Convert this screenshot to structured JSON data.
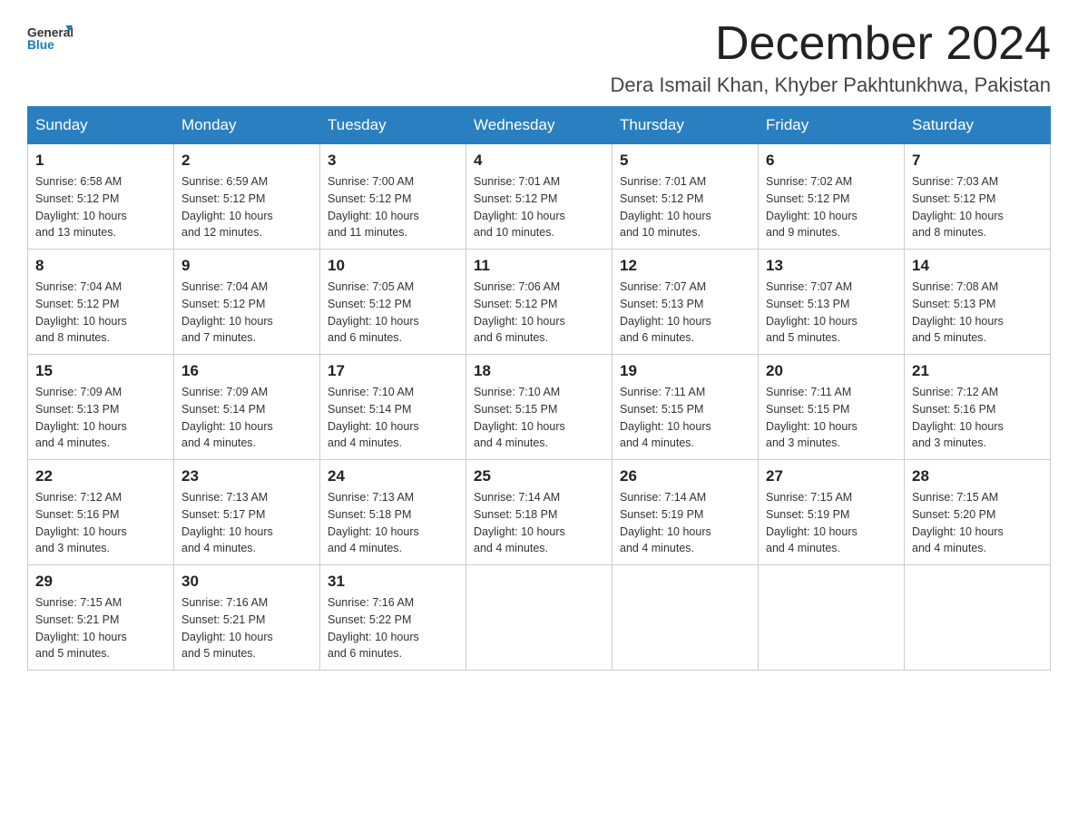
{
  "header": {
    "logo_general": "General",
    "logo_blue": "Blue",
    "month_title": "December 2024",
    "location": "Dera Ismail Khan, Khyber Pakhtunkhwa, Pakistan"
  },
  "weekdays": [
    "Sunday",
    "Monday",
    "Tuesday",
    "Wednesday",
    "Thursday",
    "Friday",
    "Saturday"
  ],
  "weeks": [
    [
      {
        "day": "1",
        "sunrise": "6:58 AM",
        "sunset": "5:12 PM",
        "daylight": "10 hours and 13 minutes."
      },
      {
        "day": "2",
        "sunrise": "6:59 AM",
        "sunset": "5:12 PM",
        "daylight": "10 hours and 12 minutes."
      },
      {
        "day": "3",
        "sunrise": "7:00 AM",
        "sunset": "5:12 PM",
        "daylight": "10 hours and 11 minutes."
      },
      {
        "day": "4",
        "sunrise": "7:01 AM",
        "sunset": "5:12 PM",
        "daylight": "10 hours and 10 minutes."
      },
      {
        "day": "5",
        "sunrise": "7:01 AM",
        "sunset": "5:12 PM",
        "daylight": "10 hours and 10 minutes."
      },
      {
        "day": "6",
        "sunrise": "7:02 AM",
        "sunset": "5:12 PM",
        "daylight": "10 hours and 9 minutes."
      },
      {
        "day": "7",
        "sunrise": "7:03 AM",
        "sunset": "5:12 PM",
        "daylight": "10 hours and 8 minutes."
      }
    ],
    [
      {
        "day": "8",
        "sunrise": "7:04 AM",
        "sunset": "5:12 PM",
        "daylight": "10 hours and 8 minutes."
      },
      {
        "day": "9",
        "sunrise": "7:04 AM",
        "sunset": "5:12 PM",
        "daylight": "10 hours and 7 minutes."
      },
      {
        "day": "10",
        "sunrise": "7:05 AM",
        "sunset": "5:12 PM",
        "daylight": "10 hours and 6 minutes."
      },
      {
        "day": "11",
        "sunrise": "7:06 AM",
        "sunset": "5:12 PM",
        "daylight": "10 hours and 6 minutes."
      },
      {
        "day": "12",
        "sunrise": "7:07 AM",
        "sunset": "5:13 PM",
        "daylight": "10 hours and 6 minutes."
      },
      {
        "day": "13",
        "sunrise": "7:07 AM",
        "sunset": "5:13 PM",
        "daylight": "10 hours and 5 minutes."
      },
      {
        "day": "14",
        "sunrise": "7:08 AM",
        "sunset": "5:13 PM",
        "daylight": "10 hours and 5 minutes."
      }
    ],
    [
      {
        "day": "15",
        "sunrise": "7:09 AM",
        "sunset": "5:13 PM",
        "daylight": "10 hours and 4 minutes."
      },
      {
        "day": "16",
        "sunrise": "7:09 AM",
        "sunset": "5:14 PM",
        "daylight": "10 hours and 4 minutes."
      },
      {
        "day": "17",
        "sunrise": "7:10 AM",
        "sunset": "5:14 PM",
        "daylight": "10 hours and 4 minutes."
      },
      {
        "day": "18",
        "sunrise": "7:10 AM",
        "sunset": "5:15 PM",
        "daylight": "10 hours and 4 minutes."
      },
      {
        "day": "19",
        "sunrise": "7:11 AM",
        "sunset": "5:15 PM",
        "daylight": "10 hours and 4 minutes."
      },
      {
        "day": "20",
        "sunrise": "7:11 AM",
        "sunset": "5:15 PM",
        "daylight": "10 hours and 3 minutes."
      },
      {
        "day": "21",
        "sunrise": "7:12 AM",
        "sunset": "5:16 PM",
        "daylight": "10 hours and 3 minutes."
      }
    ],
    [
      {
        "day": "22",
        "sunrise": "7:12 AM",
        "sunset": "5:16 PM",
        "daylight": "10 hours and 3 minutes."
      },
      {
        "day": "23",
        "sunrise": "7:13 AM",
        "sunset": "5:17 PM",
        "daylight": "10 hours and 4 minutes."
      },
      {
        "day": "24",
        "sunrise": "7:13 AM",
        "sunset": "5:18 PM",
        "daylight": "10 hours and 4 minutes."
      },
      {
        "day": "25",
        "sunrise": "7:14 AM",
        "sunset": "5:18 PM",
        "daylight": "10 hours and 4 minutes."
      },
      {
        "day": "26",
        "sunrise": "7:14 AM",
        "sunset": "5:19 PM",
        "daylight": "10 hours and 4 minutes."
      },
      {
        "day": "27",
        "sunrise": "7:15 AM",
        "sunset": "5:19 PM",
        "daylight": "10 hours and 4 minutes."
      },
      {
        "day": "28",
        "sunrise": "7:15 AM",
        "sunset": "5:20 PM",
        "daylight": "10 hours and 4 minutes."
      }
    ],
    [
      {
        "day": "29",
        "sunrise": "7:15 AM",
        "sunset": "5:21 PM",
        "daylight": "10 hours and 5 minutes."
      },
      {
        "day": "30",
        "sunrise": "7:16 AM",
        "sunset": "5:21 PM",
        "daylight": "10 hours and 5 minutes."
      },
      {
        "day": "31",
        "sunrise": "7:16 AM",
        "sunset": "5:22 PM",
        "daylight": "10 hours and 6 minutes."
      },
      null,
      null,
      null,
      null
    ]
  ],
  "labels": {
    "sunrise": "Sunrise:",
    "sunset": "Sunset:",
    "daylight": "Daylight:"
  }
}
